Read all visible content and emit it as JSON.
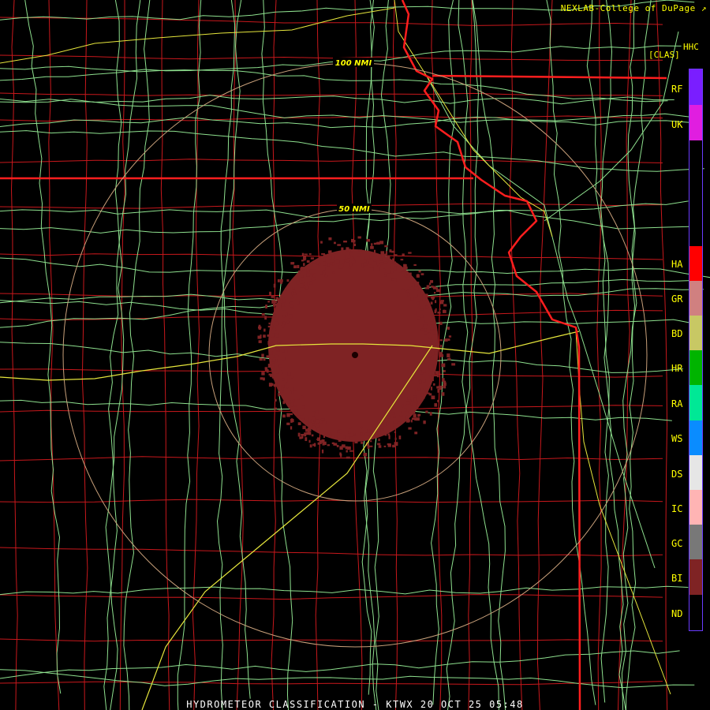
{
  "header": {
    "credit": "NEXLAB-College of DuPage",
    "product_code": "HHC",
    "product_class": "[CLAS]"
  },
  "footer": {
    "title": "HYDROMETEOR CLASSIFICATION - KTWX 20 OCT 25 05:48"
  },
  "range_rings": [
    {
      "label": "50 NMI"
    },
    {
      "label": "100 NMI"
    }
  ],
  "colors": {
    "state_border": "#ff1e1e",
    "county_line": "#c8181c",
    "road": "#8ee08e",
    "interstate": "#e6e63c",
    "range_ring": "#c8a07a",
    "echo_bi": "#7f2324"
  },
  "legend": [
    {
      "code": "RF",
      "color": "#7a1eff"
    },
    {
      "code": "UK",
      "color": "#e01ee0"
    },
    {
      "code": "HA",
      "color": "#ff0000"
    },
    {
      "code": "GR",
      "color": "#d08080"
    },
    {
      "code": "BD",
      "color": "#c8c864"
    },
    {
      "code": "HR",
      "color": "#00b400"
    },
    {
      "code": "RA",
      "color": "#00e896"
    },
    {
      "code": "WS",
      "color": "#0a8cff"
    },
    {
      "code": "DS",
      "color": "#e6e6e6"
    },
    {
      "code": "IC",
      "color": "#ffb4b4"
    },
    {
      "code": "GC",
      "color": "#787878"
    },
    {
      "code": "BI",
      "color": "#7f2324"
    },
    {
      "code": "ND",
      "color": "#000000"
    }
  ]
}
